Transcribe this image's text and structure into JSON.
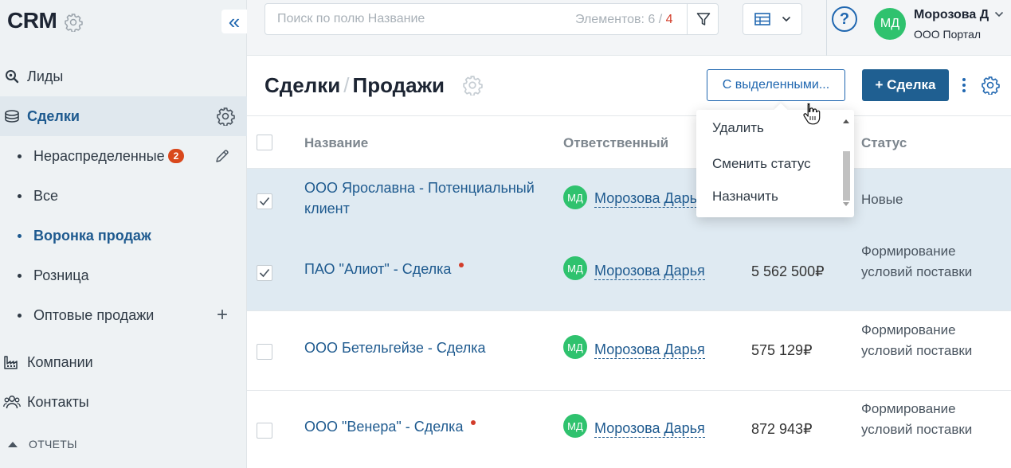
{
  "sidebar": {
    "logo": "CRM",
    "collapse_icon": "«",
    "nav": [
      {
        "label": "Лиды",
        "icon": "search-icon"
      },
      {
        "label": "Сделки",
        "icon": "coins-icon",
        "active": true
      },
      {
        "label": "Компании",
        "icon": "factory-icon"
      },
      {
        "label": "Контакты",
        "icon": "people-icon"
      }
    ],
    "deals_sub": [
      {
        "label": "Нераспределенные",
        "badge": "2"
      },
      {
        "label": "Все"
      },
      {
        "label": "Воронка продаж",
        "current": true
      },
      {
        "label": "Розница"
      },
      {
        "label": "Оптовые продажи",
        "action": "+"
      }
    ],
    "reports_label": "ОТЧЕТЫ"
  },
  "topbar": {
    "search_placeholder": "Поиск по полю Название",
    "count_label": "Элементов: 6",
    "count_sep": " / ",
    "count_selected": "4",
    "help": "?",
    "user": {
      "initials": "МД",
      "name": "Морозова Д",
      "org": "ООО Портал"
    }
  },
  "header": {
    "title_part1": "Сделки",
    "title_sep": "/",
    "title_part2": "Продажи",
    "selected_button": "С выделенными...",
    "add_button": "+ Сделка"
  },
  "table": {
    "columns": {
      "name": "Название",
      "responsible": "Ответственный",
      "status": "Статус"
    },
    "rows": [
      {
        "name": "ООО Ярославна - Потенциальный клиент",
        "initials": "МД",
        "responsible": "Морозова Дарья",
        "sum": "",
        "status": "Новые",
        "selected": true,
        "dot": false
      },
      {
        "name": "ПАО \"Алиот\" - Сделка",
        "initials": "МД",
        "responsible": "Морозова Дарья",
        "sum": "5 562 500₽",
        "status": "Формирование условий поставки",
        "selected": true,
        "dot": true
      },
      {
        "name": "ООО Бетельгейзе - Сделка",
        "initials": "МД",
        "responsible": "Морозова Дарья",
        "sum": "575 129₽",
        "status": "Формирование условий поставки",
        "selected": false,
        "dot": false
      },
      {
        "name": "ООО \"Венера\" - Сделка",
        "initials": "МД",
        "responsible": "Морозова Дарья",
        "sum": "872 943₽",
        "status": "Формирование условий поставки",
        "selected": false,
        "dot": true
      }
    ]
  },
  "dropdown": {
    "items": [
      "Удалить",
      "Сменить статус",
      "Назначить"
    ]
  },
  "colors": {
    "accent": "#2067b0",
    "primary_button": "#1f5f91",
    "badge": "#d9481c",
    "avatar": "#2fc26e",
    "selected_row": "#dfeaf2"
  }
}
